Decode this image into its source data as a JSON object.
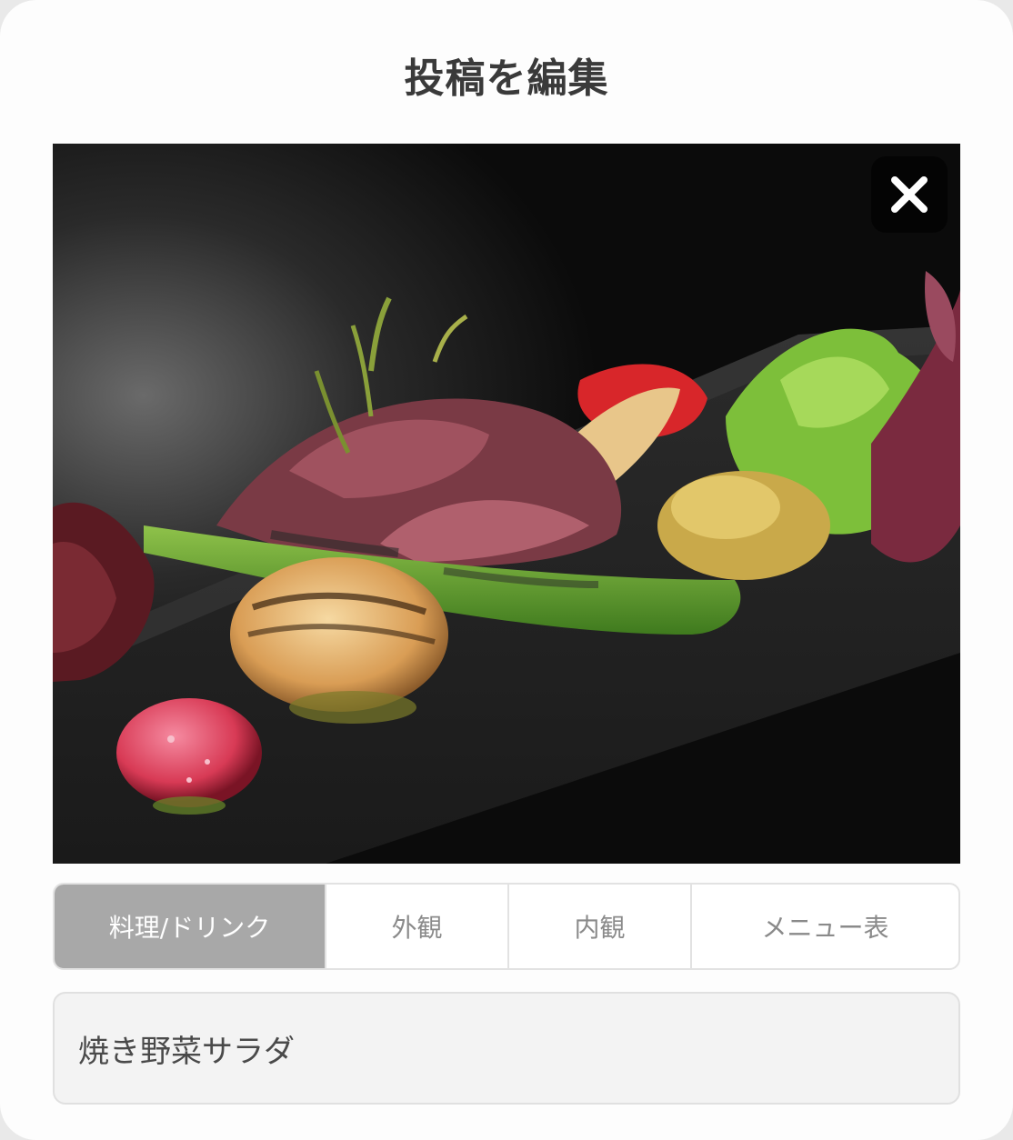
{
  "dialog": {
    "title": "投稿を編集"
  },
  "photo": {
    "alt": "焼き野菜サラダ",
    "close_icon": "close-icon"
  },
  "category_tabs": {
    "items": [
      {
        "label": "料理/ドリンク",
        "selected": true
      },
      {
        "label": "外観",
        "selected": false
      },
      {
        "label": "内観",
        "selected": false
      },
      {
        "label": "メニュー表",
        "selected": false
      }
    ]
  },
  "caption_field": {
    "value": "焼き野菜サラダ"
  },
  "colors": {
    "active_tab_bg": "#a8a8a8",
    "field_bg": "#f3f3f3",
    "title_text": "#3a3a3a"
  }
}
